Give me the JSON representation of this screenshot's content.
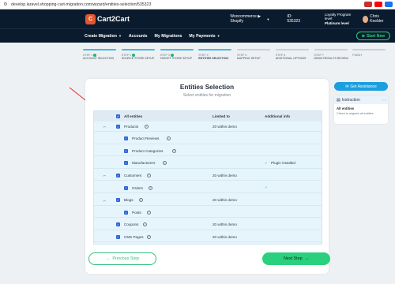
{
  "browser": {
    "url": "develop.laravel.shopping-cart-migration.com/wizard/entities-selection/535323"
  },
  "header": {
    "logo_text": "Cart2Cart",
    "logo_mark": "C",
    "platforms": "Woocommerce ▶ Shopify",
    "id_label": "ID: 535323",
    "loyalty_line1": "Loyalty Program level:",
    "loyalty_line2": "Platinum level",
    "user_name": "Chris Keebler"
  },
  "nav": {
    "items": [
      "Create Migration",
      "Accounts",
      "My Migrations",
      "My Payments"
    ],
    "start_label": "Start New"
  },
  "steps": [
    {
      "num": "STEP 1",
      "title": "ACCOUNT SELECTION",
      "state": "done"
    },
    {
      "num": "STEP 2",
      "title": "SOURCE STORE SETUP",
      "state": "done"
    },
    {
      "num": "STEP 3",
      "title": "TARGET STORE SETUP",
      "state": "done"
    },
    {
      "num": "STEP 4",
      "title": "ENTITIES SELECTION",
      "state": "active"
    },
    {
      "num": "STEP 5",
      "title": "MAPPING SETUP",
      "state": "todo"
    },
    {
      "num": "STEP 6",
      "title": "ADDITIONAL OPTIONS",
      "state": "todo"
    },
    {
      "num": "STEP 7",
      "title": "DEMO RESULTS REVIEW",
      "state": "todo"
    },
    {
      "num": "FINISH",
      "title": "",
      "state": "todo"
    }
  ],
  "main": {
    "title": "Entities Selection",
    "subtitle": "Select entities for migration",
    "table": {
      "headers": {
        "all": "All entities",
        "limit": "Limited to",
        "info": "Additional info"
      },
      "rows": [
        {
          "name": "Products",
          "limit": "20 within demo",
          "info": "",
          "level": 0,
          "caret": true,
          "icon": true
        },
        {
          "name": "Product Reviews",
          "limit": "",
          "info": "",
          "level": 1,
          "caret": false,
          "icon": true
        },
        {
          "name": "Product Categories",
          "limit": "",
          "info": "",
          "level": 1,
          "caret": false,
          "icon": true
        },
        {
          "name": "Manufacturers",
          "limit": "",
          "info": "Plugin installed",
          "level": 1,
          "caret": false,
          "icon": true
        },
        {
          "name": "Customers",
          "limit": "20 within demo",
          "info": "",
          "level": 0,
          "caret": true,
          "icon": true
        },
        {
          "name": "Orders",
          "limit": "",
          "info": "check",
          "level": 1,
          "caret": false,
          "icon": true
        },
        {
          "name": "Blogs",
          "limit": "20 within demo",
          "info": "",
          "level": 0,
          "caret": true,
          "icon": true
        },
        {
          "name": "Posts",
          "limit": "",
          "info": "",
          "level": 1,
          "caret": false,
          "icon": true
        },
        {
          "name": "Coupons",
          "limit": "20 within demo",
          "info": "",
          "level": 0,
          "caret": false,
          "icon": true
        },
        {
          "name": "CMS Pages",
          "limit": "20 within demo",
          "info": "",
          "level": 0,
          "caret": false,
          "icon": true
        }
      ]
    },
    "prev_label": "Previous Step",
    "next_label": "Next Step"
  },
  "side": {
    "assist_label": "Get Assistance",
    "instruction_label": "Instruction",
    "instruction_title": "All entities",
    "instruction_text": "Check to migrate all entities."
  }
}
